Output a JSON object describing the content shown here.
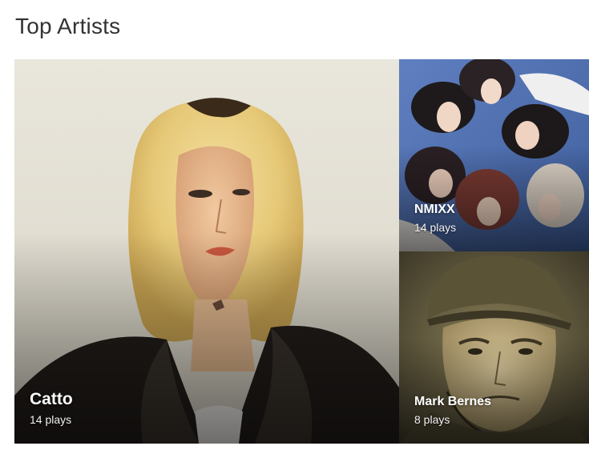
{
  "section": {
    "title": "Top Artists"
  },
  "artists": [
    {
      "name": "Catto",
      "plays": "14 plays"
    },
    {
      "name": "NMIXX",
      "plays": "14 plays"
    },
    {
      "name": "Mark Bernes",
      "plays": "8 plays"
    }
  ],
  "colors": {
    "title": "#333333",
    "overlay_text": "#ffffff"
  }
}
